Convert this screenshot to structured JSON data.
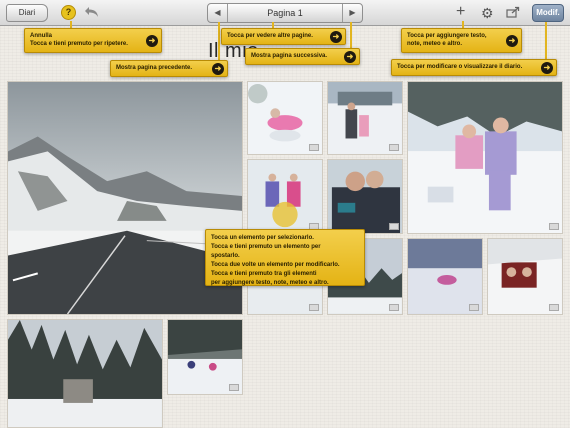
{
  "toolbar": {
    "back_label": "Diari",
    "help_label": "?",
    "pager_prev": "◀",
    "pager_title": "Pagina 1",
    "pager_next": "▶",
    "add_icon": "plus-icon",
    "settings_icon": "gear-icon",
    "share_icon": "share-icon",
    "edit_label": "Modif."
  },
  "page": {
    "title_partial": "Il mio"
  },
  "callouts": {
    "undo": "Annulla\nTocca e tieni premuto per ripetere.",
    "prev_page": "Mostra pagina precedente.",
    "other_pages": "Tocca per vedere altre pagine.",
    "next_page": "Mostra pagina successiva.",
    "add_content": "Tocca per aggiungere testo,\nnote, meteo e altro.",
    "edit_diary": "Tocca per modificare o visualizzare il diario.",
    "element_help": "Tocca un elemento per selezionarlo.\nTocca e tieni premuto un elemento per spostarlo.\nTocca due volte un elemento per modificarlo.\nTocca e tieni premuto tra gli elementi\nper aggiungere testo, note, meteo e altro."
  },
  "colors": {
    "callout_yellow": "#e9bd24",
    "edit_blue": "#7f93ad",
    "help_yellow": "#e7c21d"
  }
}
